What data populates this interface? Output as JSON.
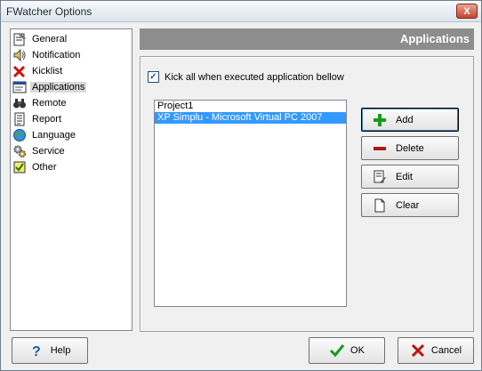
{
  "window": {
    "title": "FWatcher Options",
    "close_glyph": "X"
  },
  "nav": {
    "items": [
      {
        "label": "General",
        "icon": "notepad-icon"
      },
      {
        "label": "Notification",
        "icon": "speaker-icon"
      },
      {
        "label": "Kicklist",
        "icon": "red-x-icon"
      },
      {
        "label": "Applications",
        "icon": "window-icon"
      },
      {
        "label": "Remote",
        "icon": "binoculars-icon"
      },
      {
        "label": "Report",
        "icon": "document-icon"
      },
      {
        "label": "Language",
        "icon": "globe-icon"
      },
      {
        "label": "Service",
        "icon": "gears-icon"
      },
      {
        "label": "Other",
        "icon": "checkbox-icon"
      }
    ],
    "selected": "Applications"
  },
  "header": {
    "title": "Applications"
  },
  "kick_option": {
    "label": "Kick all when executed application bellow",
    "checked": true
  },
  "app_list": {
    "items": [
      "Project1",
      "XP Simplu - Microsoft Virtual PC 2007"
    ],
    "selected": "XP Simplu - Microsoft Virtual PC 2007"
  },
  "buttons": {
    "add": "Add",
    "delete": "Delete",
    "edit": "Edit",
    "clear": "Clear"
  },
  "footer": {
    "help": "Help",
    "ok": "OK",
    "cancel": "Cancel"
  },
  "colors": {
    "header_bg": "#8d8d8d",
    "selection": "#3399ff"
  }
}
